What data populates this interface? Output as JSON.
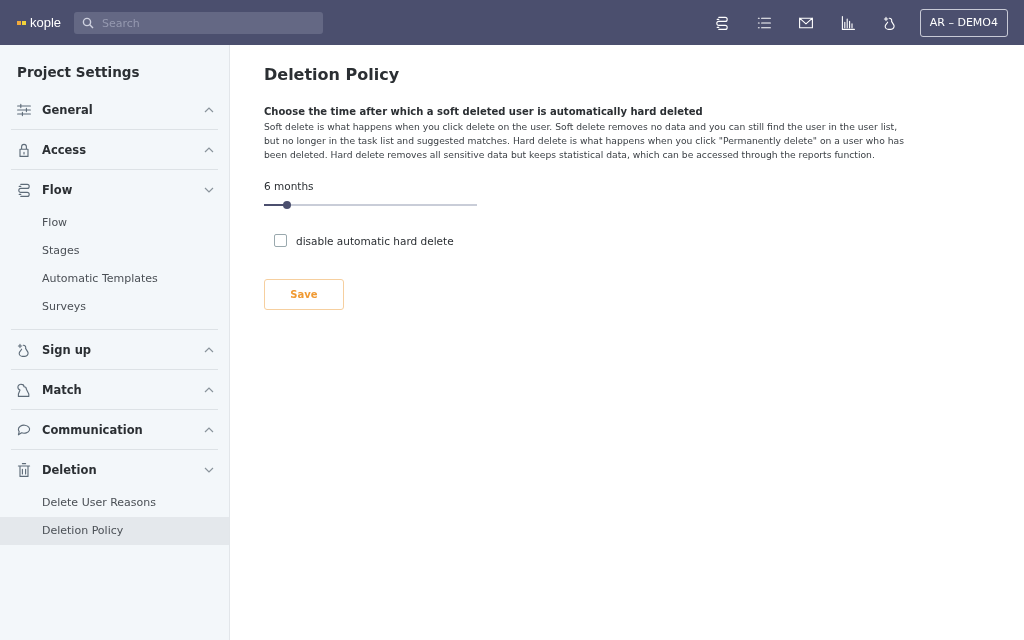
{
  "header": {
    "logo": "kople",
    "search": {
      "placeholder": "Search"
    },
    "icons": [
      {
        "kind": "flow"
      },
      {
        "kind": "list"
      },
      {
        "kind": "mail"
      },
      {
        "kind": "chart"
      },
      {
        "kind": "signup"
      }
    ],
    "account": "AR – DEMO4"
  },
  "sidebar": {
    "title": "Project Settings",
    "sections": [
      {
        "label": "General",
        "kind": "sliders",
        "expanded": false
      },
      {
        "label": "Access",
        "kind": "lock",
        "expanded": false
      },
      {
        "label": "Flow",
        "kind": "flow",
        "expanded": true,
        "children": [
          {
            "label": "Flow",
            "selected": false
          },
          {
            "label": "Stages",
            "selected": false
          },
          {
            "label": "Automatic Templates",
            "selected": false
          },
          {
            "label": "Surveys",
            "selected": false
          }
        ]
      },
      {
        "label": "Sign up",
        "kind": "signup",
        "expanded": false
      },
      {
        "label": "Match",
        "kind": "match",
        "expanded": false
      },
      {
        "label": "Communication",
        "kind": "chat",
        "expanded": false
      },
      {
        "label": "Deletion",
        "kind": "trash",
        "expanded": true,
        "children": [
          {
            "label": "Delete User Reasons",
            "selected": false
          },
          {
            "label": "Deletion Policy",
            "selected": true
          }
        ]
      }
    ]
  },
  "main": {
    "title": "Deletion Policy",
    "heading": "Choose the time after which a soft deleted user is automatically hard deleted",
    "description": "Soft delete is what happens when you click delete on the user. Soft delete removes no data and you can still find the user in the user list, but no longer in the task list and suggested matches. Hard delete is what happens when you click \"Permanently delete\" on a user who has been deleted. Hard delete removes all sensitive data but keeps statistical data, which can be accessed through the reports function.",
    "slider": {
      "reading": "6 months",
      "level": 0.11
    },
    "checkbox": {
      "label": "disable automatic hard delete",
      "checked": false
    },
    "button": "Save"
  }
}
